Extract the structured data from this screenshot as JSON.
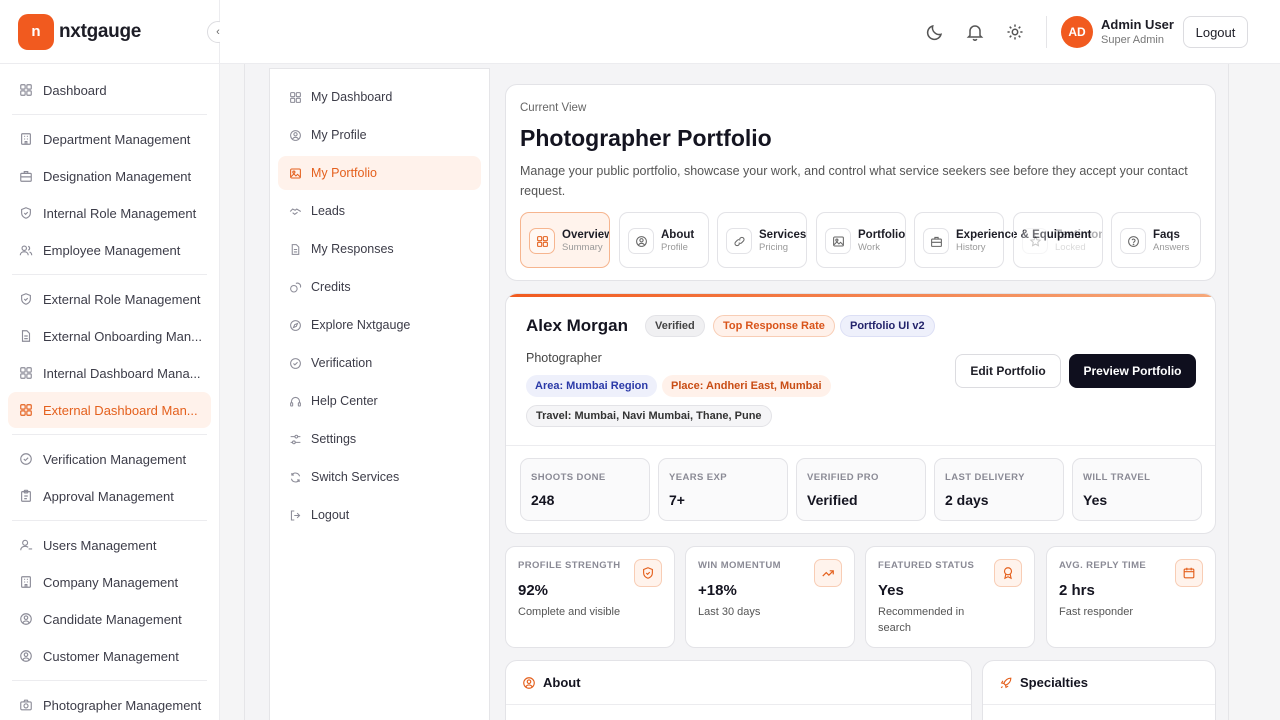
{
  "brand": {
    "mark": "n",
    "name": "nxtgauge"
  },
  "sidebar": {
    "collapse_glyph": "‹",
    "items": [
      {
        "label": "Dashboard",
        "icon": "grid-icon"
      },
      {
        "label": "Department Management",
        "icon": "building-icon"
      },
      {
        "label": "Designation Management",
        "icon": "briefcase-icon"
      },
      {
        "label": "Internal Role Management",
        "icon": "shield-icon"
      },
      {
        "label": "Employee Management",
        "icon": "users-icon"
      },
      {
        "label": "External Role Management",
        "icon": "shield-icon"
      },
      {
        "label": "External Onboarding Man...",
        "icon": "document-icon"
      },
      {
        "label": "Internal Dashboard Mana...",
        "icon": "grid-icon"
      },
      {
        "label": "External Dashboard Man...",
        "icon": "grid-icon",
        "active": true
      },
      {
        "label": "Verification Management",
        "icon": "check-circle-icon"
      },
      {
        "label": "Approval Management",
        "icon": "clipboard-icon"
      },
      {
        "label": "Users Management",
        "icon": "user-icon"
      },
      {
        "label": "Company Management",
        "icon": "building-icon"
      },
      {
        "label": "Candidate Management",
        "icon": "user-circle-icon"
      },
      {
        "label": "Customer Management",
        "icon": "user-circle-icon"
      },
      {
        "label": "Photographer Management",
        "icon": "camera-icon"
      }
    ]
  },
  "topbar": {
    "user_initials": "AD",
    "user_name": "Admin User",
    "user_role": "Super Admin",
    "logout_label": "Logout"
  },
  "portal_nav": {
    "items": [
      {
        "label": "My Dashboard",
        "icon": "grid-icon"
      },
      {
        "label": "My Profile",
        "icon": "user-circle-icon"
      },
      {
        "label": "My Portfolio",
        "icon": "image-icon",
        "active": true
      },
      {
        "label": "Leads",
        "icon": "handshake-icon"
      },
      {
        "label": "My Responses",
        "icon": "document-icon"
      },
      {
        "label": "Credits",
        "icon": "coins-icon"
      },
      {
        "label": "Explore Nxtgauge",
        "icon": "compass-icon"
      },
      {
        "label": "Verification",
        "icon": "check-circle-icon"
      },
      {
        "label": "Help Center",
        "icon": "headset-icon"
      },
      {
        "label": "Settings",
        "icon": "sliders-icon"
      },
      {
        "label": "Switch Services",
        "icon": "refresh-icon"
      },
      {
        "label": "Logout",
        "icon": "logout-icon"
      }
    ]
  },
  "current_view": {
    "label": "Current View",
    "title": "Photographer Portfolio",
    "description": "Manage your public portfolio, showcase your work, and control what service seekers see before they accept your contact request.",
    "tabs": [
      {
        "title": "Overview",
        "sub": "Summary",
        "icon": "grid-icon",
        "active": true
      },
      {
        "title": "About",
        "sub": "Profile",
        "icon": "user-circle-icon"
      },
      {
        "title": "Services & Pricing",
        "sub": "Pricing",
        "icon": "link-icon"
      },
      {
        "title": "Portfolio Gallery",
        "sub": "Work",
        "icon": "image-icon"
      },
      {
        "title": "Experience & Equipment",
        "sub": "History",
        "icon": "briefcase-icon"
      },
      {
        "title": "Testimonials",
        "sub": "Locked",
        "icon": "star-icon",
        "locked": true
      },
      {
        "title": "Faqs",
        "sub": "Answers",
        "icon": "question-icon"
      }
    ]
  },
  "profile": {
    "name": "Alex Morgan",
    "badges": [
      "Verified",
      "Top Response Rate",
      "Portfolio UI v2"
    ],
    "profession": "Photographer",
    "area": "Area: Mumbai Region",
    "place": "Place: Andheri East, Mumbai",
    "travel": "Travel: Mumbai, Navi Mumbai, Thane, Pune",
    "edit_label": "Edit Portfolio",
    "preview_label": "Preview Portfolio",
    "stats": [
      {
        "label": "SHOOTS DONE",
        "value": "248"
      },
      {
        "label": "YEARS EXP",
        "value": "7+"
      },
      {
        "label": "VERIFIED PRO",
        "value": "Verified"
      },
      {
        "label": "LAST DELIVERY",
        "value": "2 days"
      },
      {
        "label": "WILL TRAVEL",
        "value": "Yes"
      }
    ]
  },
  "metrics": [
    {
      "label": "PROFILE STRENGTH",
      "value": "92%",
      "sub": "Complete and visible",
      "icon": "shield-icon"
    },
    {
      "label": "WIN MOMENTUM",
      "value": "+18%",
      "sub": "Last 30 days",
      "icon": "trend-up-icon"
    },
    {
      "label": "FEATURED STATUS",
      "value": "Yes",
      "sub": "Recommended in search",
      "icon": "award-icon"
    },
    {
      "label": "AVG. REPLY TIME",
      "value": "2 hrs",
      "sub": "Fast responder",
      "icon": "calendar-icon"
    }
  ],
  "sections": {
    "about": "About",
    "specialties": "Specialties"
  }
}
